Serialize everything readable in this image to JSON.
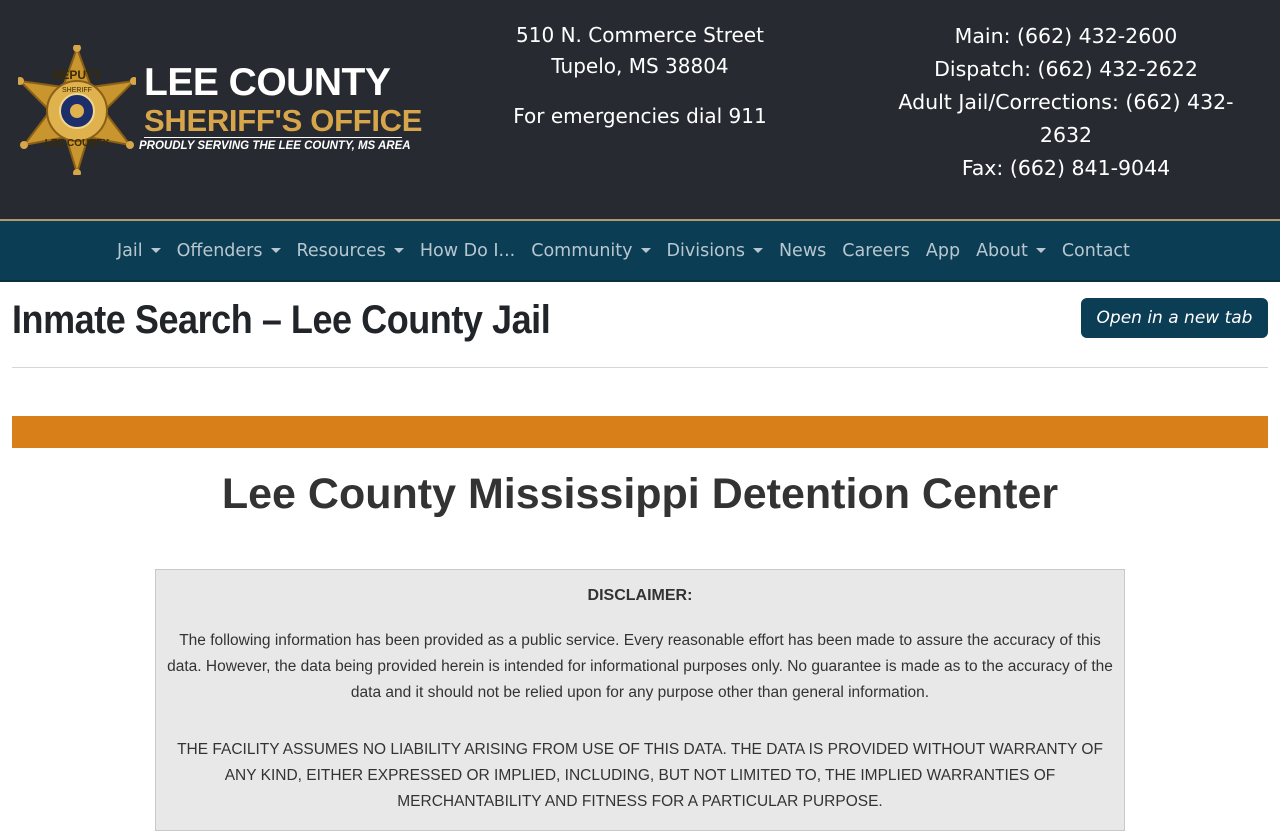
{
  "header": {
    "logo": {
      "line1": "LEE COUNTY",
      "line2": "SHERIFF'S OFFICE",
      "tagline": "PROUDLY SERVING THE LEE COUNTY, MS AREA",
      "badge_text_top": "DEPUTY",
      "badge_text_sheriff": "SHERIFF",
      "badge_text_bottom": "LEE COUNTY"
    },
    "address": {
      "street": "510 N. Commerce Street",
      "city": "Tupelo, MS 38804",
      "emergency": "For emergencies dial 911"
    },
    "phones": {
      "main": "Main: (662) 432-2600",
      "dispatch": "Dispatch: (662) 432-2622",
      "jail_line1": "Adult Jail/Corrections: (662) 432-",
      "jail_line2": "2632",
      "fax": "Fax: (662) 841-9044"
    }
  },
  "nav": {
    "items": [
      {
        "label": "Jail",
        "dropdown": true
      },
      {
        "label": "Offenders",
        "dropdown": true
      },
      {
        "label": "Resources",
        "dropdown": true
      },
      {
        "label": "How Do I...",
        "dropdown": false
      },
      {
        "label": "Community",
        "dropdown": true
      },
      {
        "label": "Divisions",
        "dropdown": true
      },
      {
        "label": "News",
        "dropdown": false
      },
      {
        "label": "Careers",
        "dropdown": false
      },
      {
        "label": "App",
        "dropdown": false
      },
      {
        "label": "About",
        "dropdown": true
      },
      {
        "label": "Contact",
        "dropdown": false
      }
    ]
  },
  "main": {
    "title": "Inmate Search – Lee County Jail",
    "open_new_tab": "Open in a new tab",
    "embed_title": "Lee County Mississippi Detention Center",
    "disclaimer": {
      "heading": "DISCLAIMER:",
      "paragraph1": "The following information has been provided as a public service. Every reasonable effort has been made to assure the accuracy of this data. However, the data being provided herein is intended for informational purposes only. No guarantee is made as to the accuracy of the data and it should not be relied upon for any purpose other than general information.",
      "paragraph2": "THE FACILITY ASSUMES NO LIABILITY ARISING FROM USE OF THIS DATA. THE DATA IS PROVIDED WITHOUT WARRANTY OF ANY KIND, EITHER EXPRESSED OR IMPLIED, INCLUDING, BUT NOT LIMITED TO, THE IMPLIED WARRANTIES OF MERCHANTABILITY AND FITNESS FOR A PARTICULAR PURPOSE."
    }
  },
  "colors": {
    "header_bg": "#272b31",
    "nav_bg": "#0b3d55",
    "gold": "#d7a54a",
    "orange_bar": "#d97f1a"
  },
  "icons": {
    "badge": "sheriff-star-badge-icon",
    "caret": "caret-down-icon"
  }
}
